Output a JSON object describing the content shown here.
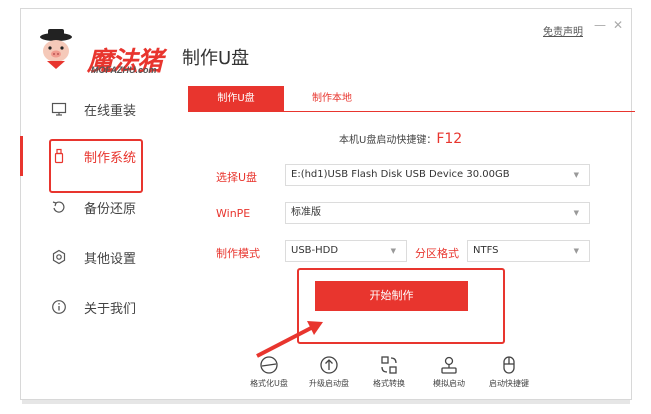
{
  "app": {
    "logo_text": "魔法猪",
    "logo_sub": "MOFAZHU.com",
    "title": "制作U盘",
    "disclaimer": "免责声明",
    "minimize": "—",
    "close": "✕"
  },
  "sidebar": {
    "items": [
      {
        "label": "在线重装",
        "icon": "monitor-icon"
      },
      {
        "label": "制作系统",
        "icon": "usb-drive-icon"
      },
      {
        "label": "备份还原",
        "icon": "backup-icon"
      },
      {
        "label": "其他设置",
        "icon": "gear-icon"
      },
      {
        "label": "关于我们",
        "icon": "info-icon"
      }
    ],
    "active": "制作系统"
  },
  "tabs": [
    {
      "label": "制作U盘"
    },
    {
      "label": "制作本地"
    }
  ],
  "hotkey": {
    "label": "本机U盘启动快捷键：",
    "key": "F12"
  },
  "form": {
    "usb": {
      "label": "选择U盘",
      "value": "E:(hd1)USB Flash Disk USB Device 30.00GB"
    },
    "winpe": {
      "label": "WinPE",
      "value": "标准版"
    },
    "mode": {
      "label": "制作模式",
      "value": "USB-HDD"
    },
    "partition": {
      "label": "分区格式",
      "value": "NTFS"
    }
  },
  "start_button": "开始制作",
  "tools": [
    {
      "label": "格式化U盘",
      "icon": "format-icon"
    },
    {
      "label": "升级启动盘",
      "icon": "upgrade-icon"
    },
    {
      "label": "格式转换",
      "icon": "convert-icon"
    },
    {
      "label": "模拟启动",
      "icon": "simulate-icon"
    },
    {
      "label": "启动快捷键",
      "icon": "mouse-icon"
    }
  ],
  "colors": {
    "accent": "#e8352e"
  }
}
